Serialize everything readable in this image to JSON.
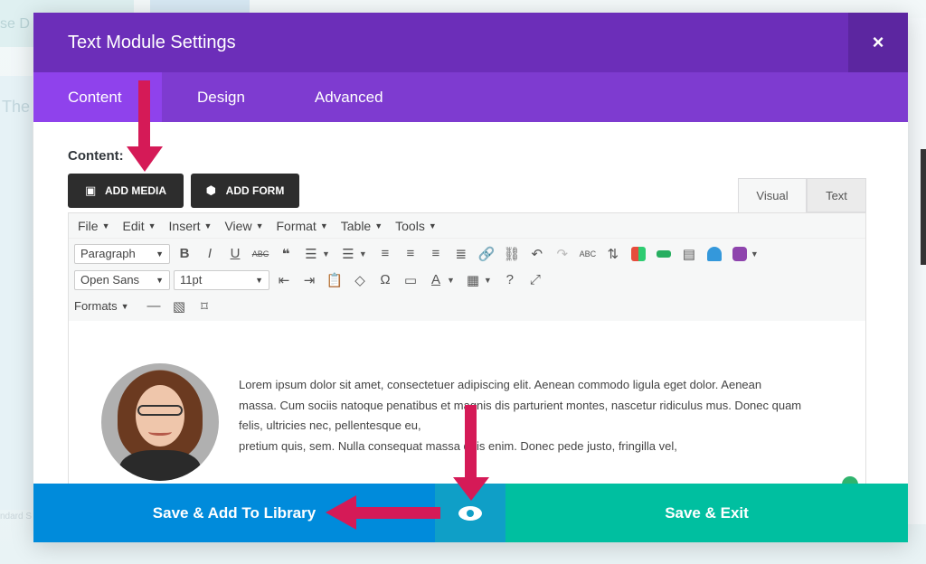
{
  "background": {
    "ghost_text_1": "se D",
    "ghost_text_2": "The",
    "ghost_text_3": "ndard S"
  },
  "modal": {
    "title": "Text Module Settings",
    "close_symbol": "×"
  },
  "tabs": [
    {
      "label": "Content"
    },
    {
      "label": "Design"
    },
    {
      "label": "Advanced"
    }
  ],
  "content": {
    "label": "Content:",
    "add_media": "ADD MEDIA",
    "add_form": "ADD FORM",
    "editor_tabs": {
      "visual": "Visual",
      "text": "Text"
    }
  },
  "menubar": [
    "File",
    "Edit",
    "Insert",
    "View",
    "Format",
    "Table",
    "Tools"
  ],
  "toolbar": {
    "paragraph": "Paragraph",
    "font": "Open Sans",
    "size": "11pt",
    "formats": "Formats",
    "bold": "B",
    "italic": "I",
    "underline": "U",
    "strike": "ABC",
    "quote": "❝",
    "omega": "Ω",
    "help": "?",
    "spell": "ABC"
  },
  "editor_text": {
    "line1": "Lorem ipsum dolor sit amet, consectetuer adipiscing elit. Aenean commodo ligula eget dolor. Aenean",
    "line2": "massa. Cum sociis natoque penatibus et magnis dis parturient montes, nascetur ridiculus mus. Donec quam",
    "line3": "felis, ultricies nec, pellentesque eu,",
    "line4": "pretium quis, sem. Nulla consequat massa quis enim. Donec pede justo, fringilla vel,"
  },
  "footer": {
    "save_library": "Save & Add To Library",
    "save_exit": "Save & Exit"
  },
  "colors": {
    "header": "#6c2eb9",
    "tabs": "#7e3bd0",
    "active_tab": "#8f42ec",
    "save_library": "#008bdb",
    "save_exit": "#00bfa0",
    "arrow": "#d51a57"
  }
}
